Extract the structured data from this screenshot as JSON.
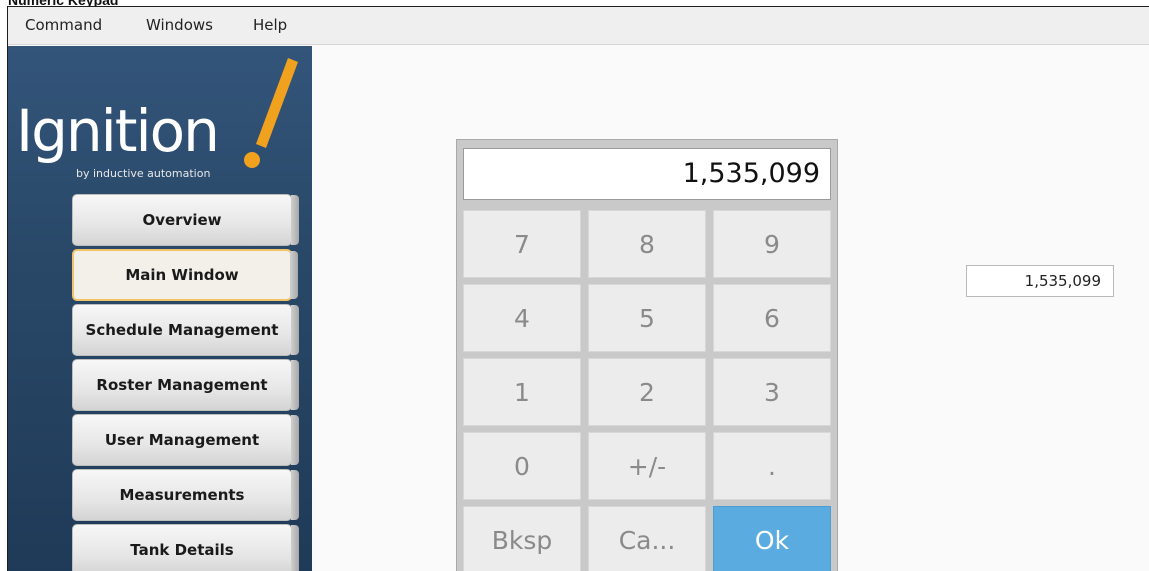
{
  "window": {
    "caption": "Numeric Keypad"
  },
  "menubar": {
    "items": [
      "Command",
      "Windows",
      "Help"
    ]
  },
  "sidebar": {
    "logo": {
      "text": "Ignition",
      "subtitle": "by inductive automation",
      "accent_color": "#f0a21f"
    },
    "nav": [
      {
        "label": "Overview",
        "active": false
      },
      {
        "label": "Main Window",
        "active": true
      },
      {
        "label": "Schedule Management",
        "active": false
      },
      {
        "label": "Roster Management",
        "active": false
      },
      {
        "label": "User Management",
        "active": false
      },
      {
        "label": "Measurements",
        "active": false
      },
      {
        "label": "Tank Details",
        "active": false
      }
    ]
  },
  "keypad": {
    "display_value": "1,535,099",
    "keys": {
      "seven": "7",
      "eight": "8",
      "nine": "9",
      "four": "4",
      "five": "5",
      "six": "6",
      "one": "1",
      "two": "2",
      "three": "3",
      "zero": "0",
      "plus_minus": "+/-",
      "decimal": ".",
      "backspace": "Bksp",
      "cancel": "Ca...",
      "ok": "Ok"
    },
    "ok_color": "#5aace0"
  },
  "numeric_field": {
    "value": "1,535,099"
  }
}
